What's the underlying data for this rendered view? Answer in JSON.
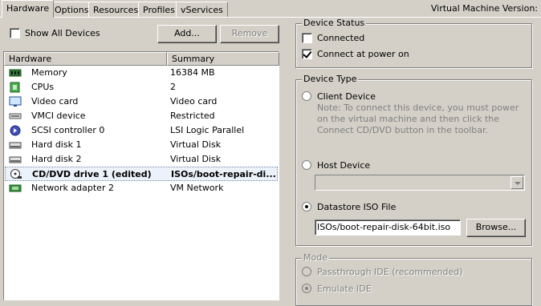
{
  "tabs": [
    "Hardware",
    "Options",
    "Resources",
    "Profiles",
    "vServices"
  ],
  "vm_version_label": "Virtual Machine Version:",
  "show_all_devices": {
    "label": "Show All Devices",
    "checked": false
  },
  "buttons": {
    "add": "Add...",
    "remove": "Remove",
    "browse": "Browse..."
  },
  "list": {
    "columns": [
      "Hardware",
      "Summary"
    ],
    "rows": [
      {
        "hardware": "Memory",
        "summary": "16384 MB",
        "icon": "memory-icon"
      },
      {
        "hardware": "CPUs",
        "summary": "2",
        "icon": "cpu-icon"
      },
      {
        "hardware": "Video card",
        "summary": "Video card",
        "icon": "monitor-icon"
      },
      {
        "hardware": "VMCI device",
        "summary": "Restricted",
        "icon": "vmci-device-icon"
      },
      {
        "hardware": "SCSI controller 0",
        "summary": "LSI Logic Parallel",
        "icon": "scsi-controller-icon"
      },
      {
        "hardware": "Hard disk 1",
        "summary": "Virtual Disk",
        "icon": "hard-disk-icon"
      },
      {
        "hardware": "Hard disk 2",
        "summary": "Virtual Disk",
        "icon": "hard-disk-icon"
      },
      {
        "hardware": "CD/DVD drive 1 (edited)",
        "summary": "ISOs/boot-repair-di...",
        "icon": "cd-dvd-icon",
        "selected": true
      },
      {
        "hardware": "Network adapter 2",
        "summary": "VM Network",
        "icon": "network-adapter-icon"
      }
    ]
  },
  "device_status": {
    "title": "Device Status",
    "connected": {
      "label": "Connected",
      "checked": false
    },
    "connect_at_power_on": {
      "label": "Connect at power on",
      "checked": true
    }
  },
  "device_type": {
    "title": "Device Type",
    "client_device": {
      "label": "Client Device",
      "note": "Note: To connect this device, you must power on the virtual machine and then click the Connect CD/DVD button in the toolbar."
    },
    "host_device": {
      "label": "Host Device",
      "value": ""
    },
    "datastore_iso": {
      "label": "Datastore ISO File",
      "value": "ISOs/boot-repair-disk-64bit.iso"
    },
    "selected": "datastore_iso"
  },
  "mode": {
    "title": "Mode",
    "passthrough": "Passthrough IDE (recommended)",
    "emulate": "Emulate IDE",
    "selected": "emulate"
  }
}
